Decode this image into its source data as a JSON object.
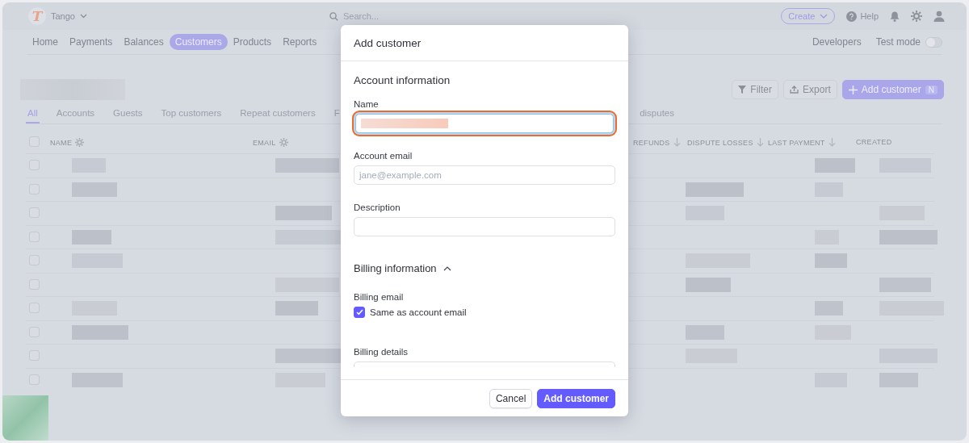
{
  "app": {
    "logo": "T",
    "account": "Tango",
    "search": {
      "placeholder": "Search..."
    },
    "create": "Create",
    "help": "Help",
    "nav": [
      {
        "label": "Home",
        "selected": false
      },
      {
        "label": "Payments",
        "selected": false
      },
      {
        "label": "Balances",
        "selected": false
      },
      {
        "label": "Customers",
        "selected": true
      },
      {
        "label": "Products",
        "selected": false
      },
      {
        "label": "Reports",
        "selected": false
      }
    ],
    "developers": "Developers",
    "test_mode": {
      "label": "Test mode",
      "on": false
    },
    "toolbar": {
      "filter": "Filter",
      "export": "Export",
      "add": "Add customer",
      "shortcut": "N"
    },
    "tabs": [
      {
        "label": "All",
        "selected": true
      },
      {
        "label": "Accounts",
        "selected": false
      },
      {
        "label": "Guests",
        "selected": false
      },
      {
        "label": "Top customers",
        "selected": false
      },
      {
        "label": "Repeat customers",
        "selected": false
      },
      {
        "label": "F",
        "selected": false
      },
      {
        "label": "disputes",
        "selected": false
      }
    ],
    "table": {
      "select_all": {
        "checked": false
      },
      "columns": [
        {
          "label": "NAME",
          "kind": "settings"
        },
        {
          "label": "EMAIL",
          "kind": "settings"
        },
        {
          "label": "REFUNDS",
          "kind": "sort"
        },
        {
          "label": "DISPUTE LOSSES",
          "kind": "sort"
        },
        {
          "label": "LAST PAYMENT",
          "kind": "sort"
        },
        {
          "label": "CREATED",
          "kind": "plain"
        }
      ],
      "rows": [
        {
          "kind": "redacted",
          "checked": false
        },
        {
          "kind": "redacted",
          "checked": false
        },
        {
          "kind": "redacted",
          "checked": false
        },
        {
          "kind": "redacted",
          "checked": false
        },
        {
          "kind": "redacted",
          "checked": false
        },
        {
          "kind": "redacted",
          "checked": false
        },
        {
          "kind": "redacted",
          "checked": false
        },
        {
          "kind": "redacted",
          "checked": false
        },
        {
          "kind": "redacted",
          "checked": false
        },
        {
          "kind": "redacted",
          "checked": false
        }
      ]
    }
  },
  "modal": {
    "title": "Add customer",
    "items": [
      {
        "kind": "heading",
        "text": "Account information"
      },
      {
        "kind": "field",
        "label": "Name",
        "redacted": true,
        "highlighted": true
      },
      {
        "kind": "field",
        "label": "Account email",
        "placeholder": "jane@example.com"
      },
      {
        "kind": "field",
        "label": "Description"
      },
      {
        "kind": "section",
        "text": "Billing information",
        "expanded": true
      },
      {
        "kind": "label",
        "text": "Billing email"
      },
      {
        "kind": "checkbox",
        "label": "Same as account email",
        "checked": true
      },
      {
        "kind": "field",
        "label": "Billing details",
        "cut": true
      }
    ],
    "buttons": [
      {
        "label": "Cancel",
        "kind": "secondary"
      },
      {
        "label": "Add customer",
        "kind": "primary"
      }
    ]
  }
}
